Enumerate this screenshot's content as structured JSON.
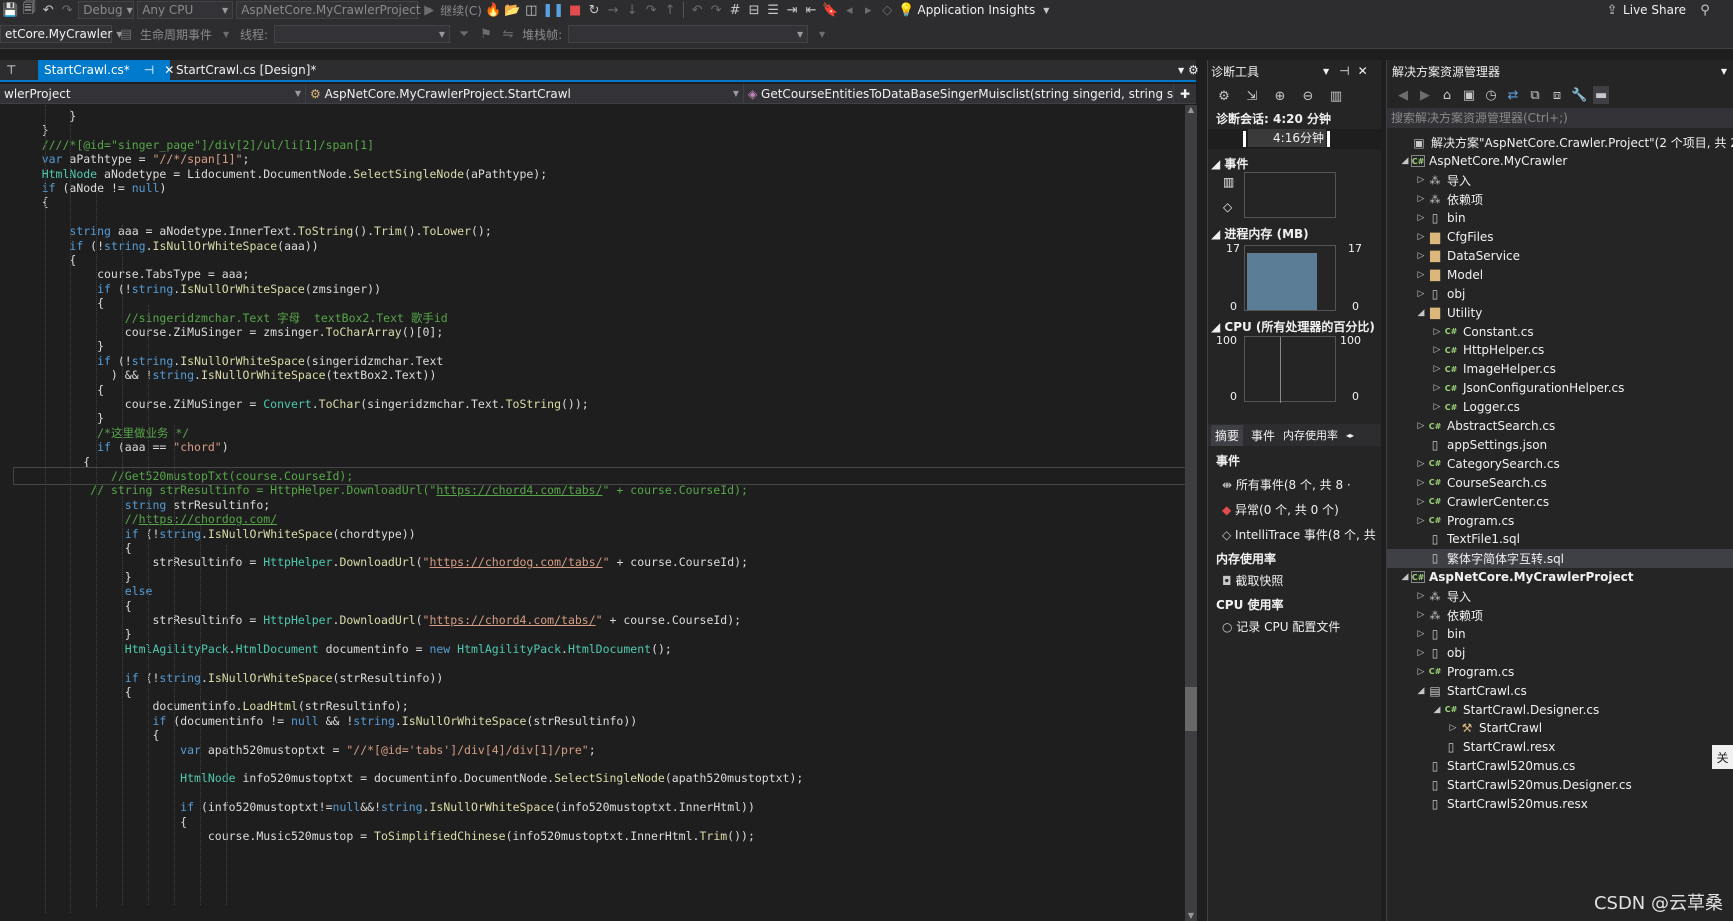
{
  "toolbar1": {
    "config": "Debug",
    "platform": "Any CPU",
    "startup_project": "AspNetCore.MyCrawlerProject",
    "continue_label": "继续(C)",
    "insights_label": "Application Insights",
    "live_share_label": "Live Share"
  },
  "toolbar2": {
    "project_combo": "etCore.MyCrawler",
    "lifecycle_label": "生命周期事件",
    "thread_label": "线程:",
    "stack_label": "堆栈帧:"
  },
  "tabs": [
    {
      "label": "StartCrawl.cs*",
      "pin": "⊣",
      "close": "✕"
    },
    {
      "label": "StartCrawl.cs [Design]*"
    }
  ],
  "navbar": {
    "project": "wlerProject",
    "class": "AspNetCore.MyCrawlerProject.StartCrawl",
    "member": "GetCourseEntitiesToDataBaseSingerMuisclist(string singerid, string si"
  },
  "code": [
    "        }",
    "    }",
    "    ////*[@id=\"singer_page\"]/div[2]/ul/li[1]/span[1]",
    "    var aPathtype = \"//*/span[1]\";",
    "    HtmlNode aNodetype = Lidocument.DocumentNode.SelectSingleNode(aPathtype);",
    "    if (aNode != null)",
    "    {",
    "",
    "        string aaa = aNodetype.InnerText.ToString().Trim().ToLower();",
    "        if (!string.IsNullOrWhiteSpace(aaa))",
    "        {",
    "            course.TabsType = aaa;",
    "            if (!string.IsNullOrWhiteSpace(zmsinger))",
    "            {",
    "                //singeridzmchar.Text 字母  textBox2.Text 歌手id",
    "                course.ZiMuSinger = zmsinger.ToCharArray()[0];",
    "            }",
    "            if (!string.IsNullOrWhiteSpace(singeridzmchar.Text",
    "              ) && !string.IsNullOrWhiteSpace(textBox2.Text))",
    "            {",
    "                course.ZiMuSinger = Convert.ToChar(singeridzmchar.Text.ToString());",
    "            }",
    "            /*这里做业务 */",
    "            if (aaa == \"chord\")",
    "          {",
    "              //Get520mustopTxt(course.CourseId);",
    "           // string strResultinfo = HttpHelper.DownloadUrl(\"https://chord4.com/tabs/\" + course.CourseId);",
    "                string strResultinfo;",
    "                //https://chordog.com/",
    "                if (!string.IsNullOrWhiteSpace(chordtype))",
    "                {",
    "                    strResultinfo = HttpHelper.DownloadUrl(\"https://chordog.com/tabs/\" + course.CourseId);",
    "                }",
    "                else",
    "                {",
    "                    strResultinfo = HttpHelper.DownloadUrl(\"https://chord4.com/tabs/\" + course.CourseId);",
    "                }",
    "                HtmlAgilityPack.HtmlDocument documentinfo = new HtmlAgilityPack.HtmlDocument();",
    "",
    "                if (!string.IsNullOrWhiteSpace(strResultinfo))",
    "                {",
    "                    documentinfo.LoadHtml(strResultinfo);",
    "                    if (documentinfo != null && !string.IsNullOrWhiteSpace(strResultinfo))",
    "                    {",
    "                        var apath520mustoptxt = \"//*[@id='tabs']/div[4]/div[1]/pre\";",
    "",
    "                        HtmlNode info520mustoptxt = documentinfo.DocumentNode.SelectSingleNode(apath520mustoptxt);",
    "",
    "                        if (info520mustoptxt!=null&&!string.IsNullOrWhiteSpace(info520mustoptxt.InnerHtml))",
    "                        {",
    "                            course.Music520mustop = ToSimplifiedChinese(info520mustoptxt.InnerHtml.Trim());"
  ],
  "diagnostics": {
    "title": "诊断工具",
    "session": "诊断会话: 4:20 分钟",
    "timeline_label": "4:16分钟",
    "events_section": "事件",
    "memory_section": "进程内存 (MB)",
    "mem_max": "17",
    "mem_min": "0",
    "mem_level": 0.95,
    "cpu_section": "CPU (所有处理器的百分比)",
    "cpu_max": "100",
    "cpu_min": "0",
    "tabs": [
      "摘要",
      "事件",
      "内存使用率"
    ],
    "events_heading": "事件",
    "event_items": [
      "所有事件(8 个, 共 8 ·",
      "异常(0 个, 共 0 个)",
      "IntelliTrace 事件(8 个, 共"
    ],
    "memory_heading": "内存使用率",
    "snapshot_label": "截取快照",
    "cpu_heading": "CPU 使用率",
    "cpu_profile_label": "记录 CPU 配置文件"
  },
  "solution": {
    "title": "解决方案资源管理器",
    "search_placeholder": "搜索解决方案资源管理器(Ctrl+;)",
    "tree": [
      {
        "label": "解决方案\"AspNetCore.Crawler.Project\"(2 个项目, 共 2",
        "icon": "solution",
        "level": 0,
        "arrow": ""
      },
      {
        "label": "AspNetCore.MyCrawler",
        "icon": "proj",
        "level": 0,
        "arrow": "◢"
      },
      {
        "label": "导入",
        "icon": "dep",
        "level": 1,
        "arrow": "▷"
      },
      {
        "label": "依赖项",
        "icon": "dep",
        "level": 1,
        "arrow": "▷"
      },
      {
        "label": "bin",
        "icon": "file",
        "level": 1,
        "arrow": "▷"
      },
      {
        "label": "CfgFiles",
        "icon": "folder",
        "level": 1,
        "arrow": "▷"
      },
      {
        "label": "DataService",
        "icon": "folder",
        "level": 1,
        "arrow": "▷"
      },
      {
        "label": "Model",
        "icon": "folder",
        "level": 1,
        "arrow": "▷"
      },
      {
        "label": "obj",
        "icon": "file",
        "level": 1,
        "arrow": "▷"
      },
      {
        "label": "Utility",
        "icon": "folder",
        "level": 1,
        "arrow": "◢"
      },
      {
        "label": "Constant.cs",
        "icon": "cs",
        "level": 2,
        "arrow": "▷"
      },
      {
        "label": "HttpHelper.cs",
        "icon": "cs",
        "level": 2,
        "arrow": "▷"
      },
      {
        "label": "ImageHelper.cs",
        "icon": "cs",
        "level": 2,
        "arrow": "▷"
      },
      {
        "label": "JsonConfigurationHelper.cs",
        "icon": "cs",
        "level": 2,
        "arrow": "▷"
      },
      {
        "label": "Logger.cs",
        "icon": "cs",
        "level": 2,
        "arrow": "▷"
      },
      {
        "label": "AbstractSearch.cs",
        "icon": "cs",
        "level": 1,
        "arrow": "▷"
      },
      {
        "label": "appSettings.json",
        "icon": "file",
        "level": 1,
        "arrow": ""
      },
      {
        "label": "CategorySearch.cs",
        "icon": "cs",
        "level": 1,
        "arrow": "▷"
      },
      {
        "label": "CourseSearch.cs",
        "icon": "cs",
        "level": 1,
        "arrow": "▷"
      },
      {
        "label": "CrawlerCenter.cs",
        "icon": "cs",
        "level": 1,
        "arrow": "▷"
      },
      {
        "label": "Program.cs",
        "icon": "cs",
        "level": 1,
        "arrow": "▷"
      },
      {
        "label": "TextFile1.sql",
        "icon": "file",
        "level": 1,
        "arrow": ""
      },
      {
        "label": "繁体字简体字互转.sql",
        "icon": "file",
        "level": 1,
        "arrow": "",
        "selected": true
      },
      {
        "label": "AspNetCore.MyCrawlerProject",
        "icon": "proj",
        "level": 0,
        "arrow": "◢",
        "bold": true
      },
      {
        "label": "导入",
        "icon": "dep",
        "level": 1,
        "arrow": "▷"
      },
      {
        "label": "依赖项",
        "icon": "dep",
        "level": 1,
        "arrow": "▷"
      },
      {
        "label": "bin",
        "icon": "file",
        "level": 1,
        "arrow": "▷"
      },
      {
        "label": "obj",
        "icon": "file",
        "level": 1,
        "arrow": "▷"
      },
      {
        "label": "Program.cs",
        "icon": "cs",
        "level": 1,
        "arrow": "▷"
      },
      {
        "label": "StartCrawl.cs",
        "icon": "form",
        "level": 1,
        "arrow": "◢"
      },
      {
        "label": "StartCrawl.Designer.cs",
        "icon": "cs",
        "level": 2,
        "arrow": "◢"
      },
      {
        "label": "StartCrawl",
        "icon": "wrench",
        "level": 3,
        "arrow": "▷"
      },
      {
        "label": "StartCrawl.resx",
        "icon": "file",
        "level": 2,
        "arrow": ""
      },
      {
        "label": "StartCrawl520mus.cs",
        "icon": "file",
        "level": 1,
        "arrow": ""
      },
      {
        "label": "StartCrawl520mus.Designer.cs",
        "icon": "file",
        "level": 1,
        "arrow": ""
      },
      {
        "label": "StartCrawl520mus.resx",
        "icon": "file",
        "level": 1,
        "arrow": ""
      }
    ]
  },
  "side_tooltip": "关",
  "watermark": "CSDN @云草桑",
  "colors": {
    "accent": "#007acc",
    "background": "#1e1e1e",
    "panel": "#252526",
    "keyword": "#569cd6",
    "type": "#4ec9b0",
    "string": "#d69d85",
    "comment": "#57a64a"
  }
}
